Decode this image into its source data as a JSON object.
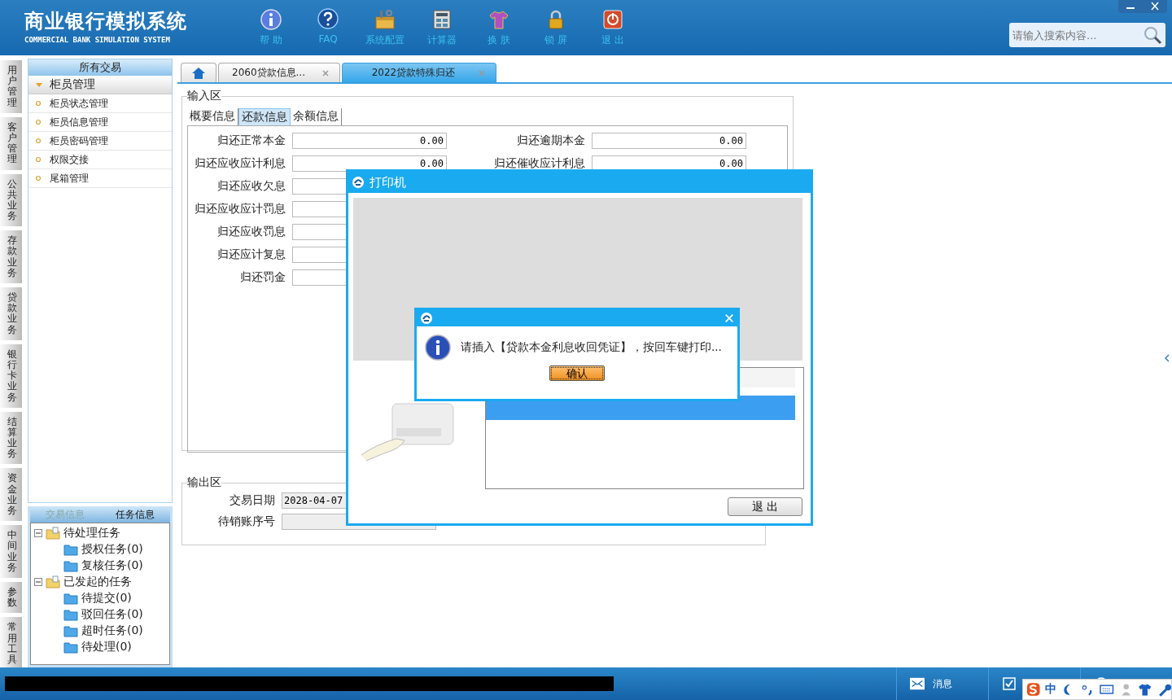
{
  "header": {
    "title": "商业银行模拟系统",
    "subtitle": "COMMERCIAL BANK SIMULATION SYSTEM",
    "tools": [
      {
        "kind": "info",
        "label": "帮 助"
      },
      {
        "kind": "faq",
        "label": "FAQ"
      },
      {
        "kind": "config",
        "label": "系统配置"
      },
      {
        "kind": "calc",
        "label": "计算器"
      },
      {
        "kind": "skin",
        "label": "换 肤"
      },
      {
        "kind": "lock",
        "label": "锁 屏"
      },
      {
        "kind": "exit",
        "label": "退 出"
      }
    ],
    "search": {
      "placeholder": "请输入搜索内容..."
    }
  },
  "side_tabs": [
    {
      "label": "用户管理"
    },
    {
      "label": "客户管理"
    },
    {
      "label": "公共业务"
    },
    {
      "label": "存款业务"
    },
    {
      "label": "贷款业务"
    },
    {
      "label": "银行卡业务"
    },
    {
      "label": "结算业务"
    },
    {
      "label": "资金业务"
    },
    {
      "label": "中间业务"
    },
    {
      "label": "参数"
    },
    {
      "label": "常用工具"
    }
  ],
  "sidebar": {
    "title": "所有交易",
    "group": {
      "label": "柜员管理",
      "expanded": true,
      "items": [
        {
          "label": "柜员状态管理"
        },
        {
          "label": "柜员信息管理"
        },
        {
          "label": "柜员密码管理"
        },
        {
          "label": "权限交接"
        },
        {
          "label": "尾箱管理"
        }
      ]
    }
  },
  "task_panel": {
    "tabs": [
      {
        "label": "交易信息",
        "selected": false
      },
      {
        "label": "任务信息",
        "selected": true
      }
    ],
    "tree": [
      {
        "label": "待处理任务",
        "expanded": true,
        "children": [
          {
            "label": "授权任务(0)"
          },
          {
            "label": "复核任务(0)"
          }
        ]
      },
      {
        "label": "已发起的任务",
        "expanded": true,
        "children": [
          {
            "label": "待提交(0)"
          },
          {
            "label": "驳回任务(0)"
          },
          {
            "label": "超时任务(0)"
          },
          {
            "label": "待处理(0)"
          }
        ]
      }
    ]
  },
  "page_tabs": [
    {
      "kind": "home",
      "selected": false
    },
    {
      "kind": "page",
      "label": "2060贷款信息...",
      "selected": false
    },
    {
      "kind": "page",
      "label": "2022贷款特殊归还",
      "selected": true
    }
  ],
  "input_area": {
    "title": "输入区",
    "tabs": [
      {
        "label": "概要信息",
        "selected": false
      },
      {
        "label": "还款信息",
        "selected": true
      },
      {
        "label": "余额信息",
        "selected": false
      }
    ],
    "fields_left": [
      {
        "label": "归还正常本金",
        "value": "0.00"
      },
      {
        "label": "归还应收应计利息",
        "value": "0.00"
      },
      {
        "label": "归还应收欠息"
      },
      {
        "label": "归还应收应计罚息"
      },
      {
        "label": "归还应收罚息"
      },
      {
        "label": "归还应计复息"
      },
      {
        "label": "归还罚金"
      }
    ],
    "fields_right": [
      {
        "label": "归还逾期本金",
        "value": "0.00"
      },
      {
        "label": "归还催收应计利息",
        "value": "0.00"
      }
    ]
  },
  "output_area": {
    "title": "输出区",
    "fields": [
      {
        "label": "交易日期",
        "value": "2028-04-07"
      },
      {
        "label": "待销账序号"
      }
    ]
  },
  "printer_dialog": {
    "title": "打印机",
    "exit_button": "退 出"
  },
  "message_box": {
    "message": "请插入【贷款本金利息收回凭证】，按回车键打印...",
    "button": "确认"
  },
  "status_bar": {
    "items": [
      {
        "kind": "message",
        "label": "消息"
      },
      {
        "kind": "todo"
      },
      {
        "kind": "risk"
      }
    ]
  },
  "ime_bar": {
    "mode": "中"
  }
}
